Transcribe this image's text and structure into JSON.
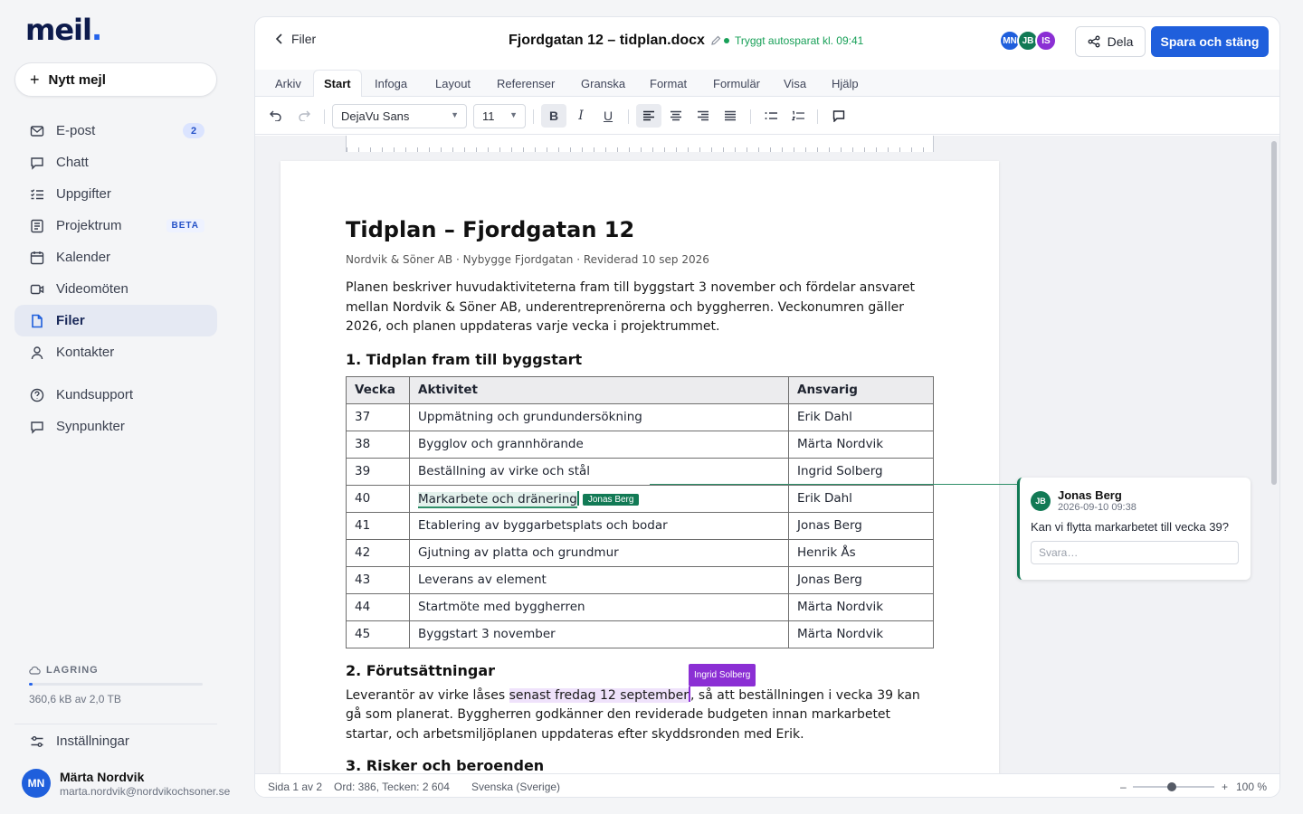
{
  "app": {
    "logo": "meil",
    "logo_dot": "."
  },
  "sidebar": {
    "compose_label": "Nytt mejl",
    "items": [
      {
        "label": "E-post",
        "icon": "mail-icon",
        "badge": "2"
      },
      {
        "label": "Chatt",
        "icon": "chat-icon"
      },
      {
        "label": "Uppgifter",
        "icon": "tasks-icon"
      },
      {
        "label": "Projektrum",
        "icon": "project-icon",
        "tag": "BETA"
      },
      {
        "label": "Kalender",
        "icon": "calendar-icon"
      },
      {
        "label": "Videomöten",
        "icon": "video-icon"
      },
      {
        "label": "Filer",
        "icon": "file-icon",
        "active": true
      },
      {
        "label": "Kontakter",
        "icon": "contact-icon"
      }
    ],
    "secondary": [
      {
        "label": "Kundsupport",
        "icon": "help-icon"
      },
      {
        "label": "Synpunkter",
        "icon": "feedback-icon"
      }
    ],
    "storage": {
      "label": "LAGRING",
      "text": "360,6 kB av 2,0 TB",
      "used_fraction": 0.02
    },
    "settings_label": "Inställningar",
    "user": {
      "initials": "MN",
      "name": "Märta Nordvik",
      "email": "marta.nordvik@nordvikochsoner.se"
    }
  },
  "header": {
    "back_label": "Filer",
    "doc_title": "Fjordgatan 12 – tidplan.docx",
    "saved_text": "Tryggt autosparat kl. 09:41",
    "collaborators": [
      {
        "initials": "MN",
        "color": "#1f5fdc"
      },
      {
        "initials": "JB",
        "color": "#127a55"
      },
      {
        "initials": "IS",
        "color": "#8b2fd4"
      }
    ],
    "share_label": "Dela",
    "save_label": "Spara och stäng"
  },
  "tabs": [
    "Arkiv",
    "Start",
    "Infoga",
    "Layout",
    "Referenser",
    "Granska",
    "Format",
    "Formulär",
    "Visa",
    "Hjälp"
  ],
  "active_tab": "Start",
  "toolbar": {
    "font": "DejaVu Sans",
    "size": "11",
    "bold": "B",
    "italic": "I",
    "underline": "U"
  },
  "document": {
    "title": "Tidplan – Fjordgatan 12",
    "meta": "Nordvik & Söner AB · Nybygge Fjordgatan · Reviderad 10 sep 2026",
    "intro": "Planen beskriver huvudaktiviteterna fram till byggstart 3 november och fördelar ansvaret mellan Nordvik & Söner AB, underentreprenörerna och byggherren. Veckonumren gäller 2026, och planen uppdateras varje vecka i projektrummet.",
    "section1": "1. Tidplan fram till byggstart",
    "table_headers": [
      "Vecka",
      "Aktivitet",
      "Ansvarig"
    ],
    "rows": [
      [
        "37",
        "Uppmätning och grundundersökning",
        "Erik Dahl"
      ],
      [
        "38",
        "Bygglov och grannhörande",
        "Märta Nordvik"
      ],
      [
        "39",
        "Beställning av virke och stål",
        "Ingrid Solberg"
      ],
      [
        "40",
        "Markarbete och dränering",
        "Erik Dahl"
      ],
      [
        "41",
        "Etablering av byggarbetsplats och bodar",
        "Jonas Berg"
      ],
      [
        "42",
        "Gjutning av platta och grundmur",
        "Henrik Ås"
      ],
      [
        "43",
        "Leverans av element",
        "Jonas Berg"
      ],
      [
        "44",
        "Startmöte med byggherren",
        "Märta Nordvik"
      ],
      [
        "45",
        "Byggstart 3 november",
        "Märta Nordvik"
      ]
    ],
    "highlight_row_tag": "Jonas Berg",
    "section2": "2. Förutsättningar",
    "p2_before": "Leverantör av virke låses ",
    "p2_mark": "senast fredag 12 september",
    "p2_after": ", så att beställningen i vecka 39 kan gå som planerat. Byggherren godkänner den reviderade budgeten innan markarbetet startar, och arbetsmiljöplanen uppdateras efter skyddsronden med Erik.",
    "p2_tag": "Ingrid Solberg",
    "section3": "3. Risker och beroenden"
  },
  "comment": {
    "initials": "JB",
    "author": "Jonas Berg",
    "time": "2026-09-10 09:38",
    "text": "Kan vi flytta markarbetet till vecka 39?",
    "reply_placeholder": "Svara…"
  },
  "status": {
    "page": "Sida 1 av 2",
    "counts": "Ord: 386, Tecken: 2 604",
    "language": "Svenska (Sverige)",
    "zoom_minus": "–",
    "zoom_plus": "+",
    "zoom": "100 %",
    "zoom_fraction": 0.48
  }
}
